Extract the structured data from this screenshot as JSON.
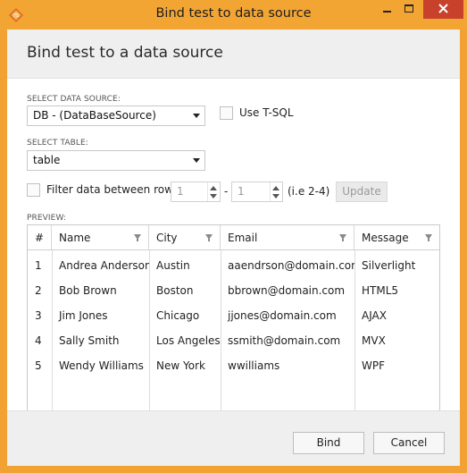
{
  "window": {
    "title": "Bind test to data source",
    "accent": "#f3a534",
    "close_color": "#c7412b"
  },
  "header": {
    "title": "Bind test to a data source"
  },
  "data_source": {
    "label": "SELECT DATA SOURCE:",
    "value": "DB - (DataBaseSource)",
    "tsql_label": "Use T-SQL",
    "tsql_checked": false
  },
  "table_select": {
    "label": "SELECT TABLE:",
    "value": "table"
  },
  "filter": {
    "label": "Filter data between rows:",
    "checked": false,
    "from": "1",
    "dash": "-",
    "to": "1",
    "hint": "(i.e 2-4)",
    "update_label": "Update"
  },
  "preview": {
    "label": "PREVIEW:",
    "columns": [
      "#",
      "Name",
      "City",
      "Email",
      "Message"
    ],
    "rows": [
      [
        "1",
        "Andrea Anderson",
        "Austin",
        "aaendrson@domain.com",
        "Silverlight"
      ],
      [
        "2",
        "Bob Brown",
        "Boston",
        "bbrown@domain.com",
        "HTML5"
      ],
      [
        "3",
        "Jim Jones",
        "Chicago",
        "jjones@domain.com",
        "AJAX"
      ],
      [
        "4",
        "Sally Smith",
        "Los Angeles",
        "ssmith@domain.com",
        "MVX"
      ],
      [
        "5",
        "Wendy Williams",
        "New York",
        "wwilliams",
        "WPF"
      ]
    ]
  },
  "footer": {
    "bind_label": "Bind",
    "cancel_label": "Cancel"
  }
}
